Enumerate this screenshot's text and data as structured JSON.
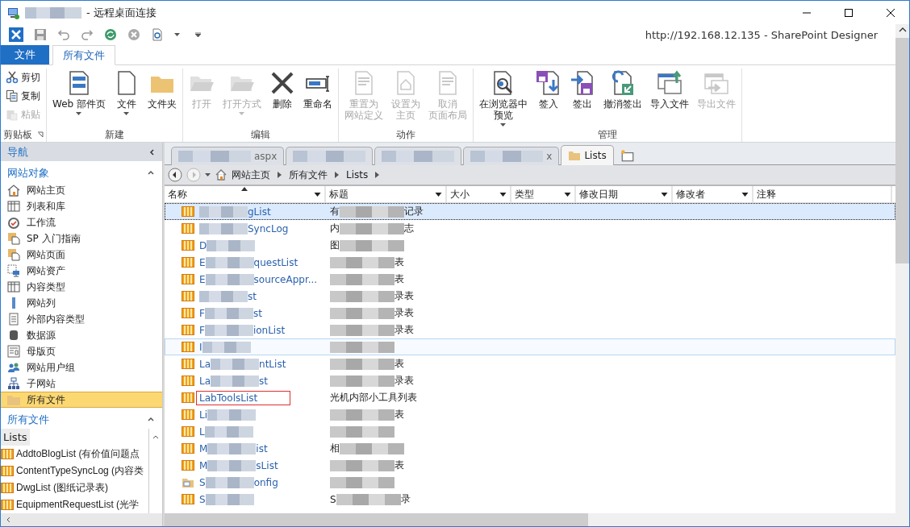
{
  "window": {
    "title": "- 远程桌面连接",
    "app_title": "http://192.168.12.135 - SharePoint Designer"
  },
  "ribbon": {
    "tabs": [
      {
        "label": "文件",
        "kind": "file",
        "selected": false
      },
      {
        "label": "所有文件",
        "kind": "tab",
        "selected": true
      }
    ],
    "groups": [
      {
        "label": "剪贴板",
        "kind": "small",
        "buttons": [
          {
            "lines": [
              "剪切"
            ],
            "disabled": false
          },
          {
            "lines": [
              "复制"
            ],
            "disabled": false
          },
          {
            "lines": [
              "粘贴"
            ],
            "disabled": true
          }
        ]
      },
      {
        "label": "新建",
        "kind": "large",
        "buttons": [
          {
            "lines": [
              "Web 部件页"
            ],
            "disabled": false,
            "dropdown": true
          },
          {
            "lines": [
              "文件"
            ],
            "disabled": false,
            "dropdown": true
          },
          {
            "lines": [
              "文件夹"
            ],
            "disabled": false
          }
        ]
      },
      {
        "label": "编辑",
        "kind": "large",
        "buttons": [
          {
            "lines": [
              "打开"
            ],
            "disabled": true
          },
          {
            "lines": [
              "打开方式"
            ],
            "disabled": true,
            "dropdown": true
          },
          {
            "lines": [
              "删除"
            ],
            "disabled": false
          },
          {
            "lines": [
              "重命名"
            ],
            "disabled": false
          }
        ]
      },
      {
        "label": "动作",
        "kind": "large",
        "buttons": [
          {
            "lines": [
              "重置为",
              "网站定义"
            ],
            "disabled": true
          },
          {
            "lines": [
              "设置为",
              "主页"
            ],
            "disabled": true
          },
          {
            "lines": [
              "取消",
              "页面布局"
            ],
            "disabled": true
          }
        ]
      },
      {
        "label": "管理",
        "kind": "large",
        "buttons": [
          {
            "lines": [
              "在浏览器中",
              "预览"
            ],
            "disabled": false,
            "dropdown": true
          },
          {
            "lines": [
              "签入"
            ],
            "disabled": false
          },
          {
            "lines": [
              "签出"
            ],
            "disabled": false
          },
          {
            "lines": [
              "撤消签出"
            ],
            "disabled": false
          },
          {
            "lines": [
              "导入文件"
            ],
            "disabled": false
          },
          {
            "lines": [
              "导出文件"
            ],
            "disabled": true
          }
        ]
      }
    ]
  },
  "navigation": {
    "title": "导航",
    "sections": [
      {
        "title": "网站对象",
        "expanded": true,
        "items": [
          {
            "label": "网站主页",
            "selected": false
          },
          {
            "label": "列表和库",
            "selected": false
          },
          {
            "label": "工作流",
            "selected": false
          },
          {
            "label": "SP 入门指南",
            "selected": false
          },
          {
            "label": "网站页面",
            "selected": false
          },
          {
            "label": "网站资产",
            "selected": false
          },
          {
            "label": "内容类型",
            "selected": false
          },
          {
            "label": "网站列",
            "selected": false
          },
          {
            "label": "外部内容类型",
            "selected": false
          },
          {
            "label": "数据源",
            "selected": false
          },
          {
            "label": "母版页",
            "selected": false
          },
          {
            "label": "网站用户组",
            "selected": false
          },
          {
            "label": "子网站",
            "selected": false
          },
          {
            "label": "所有文件",
            "selected": true
          }
        ]
      },
      {
        "title": "所有文件",
        "expanded": true,
        "folder": "Lists",
        "items": [
          {
            "label": "AddtoBlogList (有价值问题点"
          },
          {
            "label": "ContentTypeSyncLog (内容类"
          },
          {
            "label": "DwgList (图纸记录表)"
          },
          {
            "label": "EquipmentRequestList (光学"
          }
        ]
      }
    ]
  },
  "doc_tabs": [
    {
      "label": "aspx",
      "redacted": true,
      "selected": false
    },
    {
      "redacted": true,
      "selected": false
    },
    {
      "redacted": true,
      "selected": false
    },
    {
      "label": "x",
      "redacted": true,
      "selected": false
    },
    {
      "label": "Lists",
      "redacted": false,
      "selected": true
    }
  ],
  "breadcrumb": [
    "网站主页",
    "所有文件",
    "Lists"
  ],
  "table": {
    "columns": [
      {
        "label": "名称",
        "sorted": true
      },
      {
        "label": "标题",
        "sorted": false
      },
      {
        "label": "大小",
        "sorted": false
      },
      {
        "label": "类型",
        "sorted": false
      },
      {
        "label": "修改日期",
        "sorted": false
      },
      {
        "label": "修改者",
        "sorted": false
      },
      {
        "label": "注释",
        "sorted": false
      }
    ],
    "rows": [
      {
        "name": {
          "end": "gList"
        },
        "title": {
          "start": "有",
          "end": "记录"
        },
        "redacted": true,
        "kind": "list",
        "selected": true,
        "hover": false,
        "marked": false
      },
      {
        "name": {
          "end": "SyncLog"
        },
        "title": {
          "start": "内",
          "end": "志"
        },
        "redacted": true,
        "kind": "list",
        "selected": false,
        "hover": false,
        "marked": false
      },
      {
        "name": {
          "start": "D"
        },
        "title": {
          "start": "图"
        },
        "redacted": true,
        "kind": "list",
        "selected": false,
        "hover": false,
        "marked": false
      },
      {
        "name": {
          "start": "E",
          "end": "questList"
        },
        "title": {
          "end": "表"
        },
        "redacted": true,
        "kind": "list",
        "selected": false,
        "hover": false,
        "marked": false
      },
      {
        "name": {
          "start": "E",
          "end": "sourceAppr..."
        },
        "title": {
          "end": "表"
        },
        "redacted": true,
        "kind": "list",
        "selected": false,
        "hover": false,
        "marked": false
      },
      {
        "name": {
          "end": "st"
        },
        "title": {
          "end": "录表"
        },
        "redacted": true,
        "kind": "list",
        "selected": false,
        "hover": false,
        "marked": false
      },
      {
        "name": {
          "start": "F",
          "end": "st"
        },
        "title": {
          "end": "录表"
        },
        "redacted": true,
        "kind": "list",
        "selected": false,
        "hover": false,
        "marked": false
      },
      {
        "name": {
          "start": "F",
          "end": "ionList"
        },
        "title": {
          "end": "录表"
        },
        "redacted": true,
        "kind": "list",
        "selected": false,
        "hover": false,
        "marked": false
      },
      {
        "name": {
          "start": "I"
        },
        "redacted": true,
        "kind": "list",
        "selected": false,
        "hover": true,
        "marked": false
      },
      {
        "name": {
          "start": "La",
          "end": "ntList"
        },
        "title": {
          "end": "表"
        },
        "redacted": true,
        "kind": "list",
        "selected": false,
        "hover": false,
        "marked": false
      },
      {
        "name": {
          "start": "La",
          "end": "st"
        },
        "title": {
          "end": "录表"
        },
        "redacted": true,
        "kind": "list",
        "selected": false,
        "hover": false,
        "marked": false
      },
      {
        "name": {
          "start": "LabToolsList"
        },
        "title": {
          "start": "光机内部小工具列表"
        },
        "redacted": false,
        "kind": "list",
        "selected": false,
        "hover": false,
        "marked": true
      },
      {
        "name": {
          "start": "Li"
        },
        "title": {
          "end": "表"
        },
        "redacted": true,
        "kind": "list",
        "selected": false,
        "hover": false,
        "marked": false
      },
      {
        "name": {
          "start": "L"
        },
        "redacted": true,
        "kind": "list",
        "selected": false,
        "hover": false,
        "marked": false
      },
      {
        "name": {
          "start": "M",
          "end": "ist"
        },
        "title": {
          "start": "相"
        },
        "redacted": true,
        "kind": "list",
        "selected": false,
        "hover": false,
        "marked": false
      },
      {
        "name": {
          "start": "M",
          "end": "sList"
        },
        "title": {
          "end": "表"
        },
        "redacted": true,
        "kind": "list",
        "selected": false,
        "hover": false,
        "marked": false
      },
      {
        "name": {
          "start": "S",
          "end": "onfig"
        },
        "redacted": true,
        "kind": "config",
        "selected": false,
        "hover": false,
        "marked": false
      },
      {
        "name": {
          "start": "S"
        },
        "title": {
          "start": "S",
          "end": "录"
        },
        "redacted": true,
        "kind": "list",
        "selected": false,
        "hover": false,
        "marked": false
      }
    ]
  }
}
